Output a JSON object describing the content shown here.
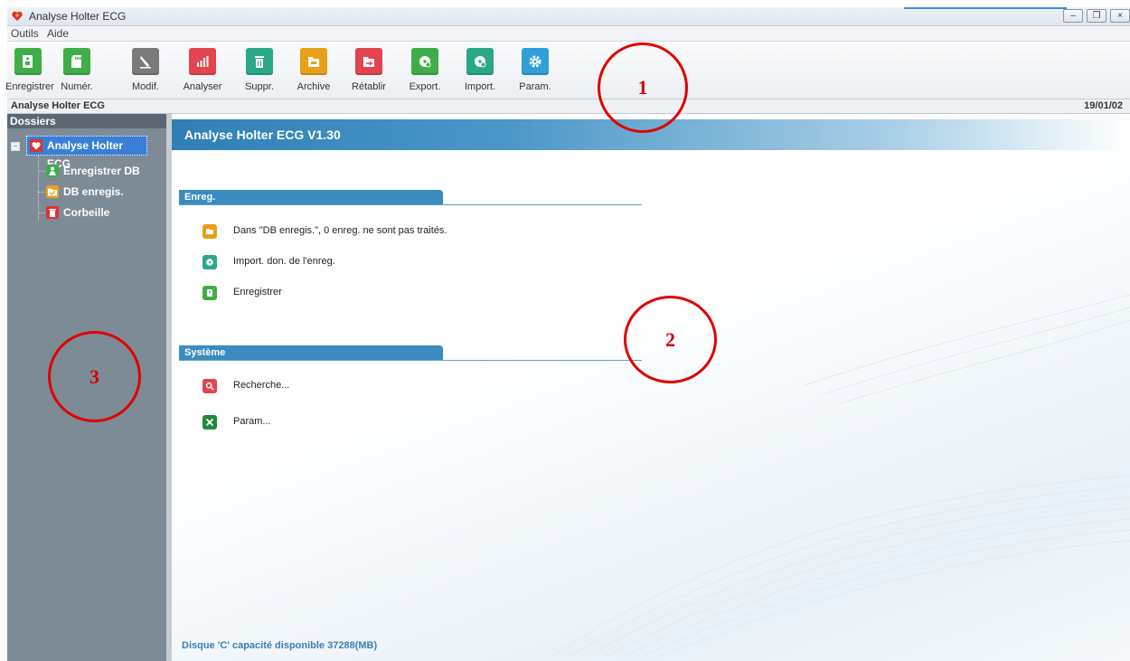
{
  "window": {
    "title": "Analyse Holter ECG"
  },
  "menu": {
    "items": [
      "Outils",
      "Aide"
    ]
  },
  "toolbar": {
    "buttons": [
      {
        "label": "Enregistrer",
        "icon": "record-icon",
        "color": "#3fae49"
      },
      {
        "label": "Numér.",
        "icon": "sd-card-icon",
        "color": "#3fae49"
      },
      {
        "label": "Modif.",
        "icon": "edit-pencil-icon",
        "color": "#7a7a7a"
      },
      {
        "label": "Analyser",
        "icon": "bar-chart-icon",
        "color": "#e2454f"
      },
      {
        "label": "Suppr.",
        "icon": "trash-icon",
        "color": "#2aa98a"
      },
      {
        "label": "Archive",
        "icon": "archive-folder-icon",
        "color": "#e8a01a"
      },
      {
        "label": "Rétablir",
        "icon": "restore-folder-icon",
        "color": "#e2454f"
      },
      {
        "label": "Export.",
        "icon": "export-disc-icon",
        "color": "#3fae49"
      },
      {
        "label": "Import.",
        "icon": "import-disc-icon",
        "color": "#2aa98a"
      },
      {
        "label": "Param.",
        "icon": "gear-icon",
        "color": "#2f9fd8"
      }
    ]
  },
  "status": {
    "left": "Analyse Holter ECG",
    "date": "19/01/02"
  },
  "sidebar": {
    "header": "Dossiers",
    "root": {
      "label": "Analyse Holter ECG",
      "icon": "heart-icon",
      "color": "#e0322e"
    },
    "items": [
      {
        "label": "Enregistrer DB",
        "icon": "person-icon",
        "color": "#3fae49"
      },
      {
        "label": "DB enregis.",
        "icon": "folder-icon",
        "color": "#e8a01a"
      },
      {
        "label": "Corbeille",
        "icon": "trash-icon",
        "color": "#e0322e"
      }
    ]
  },
  "main": {
    "title": "Analyse Holter ECG V1.30",
    "sections": [
      {
        "title": "Enreg.",
        "items": [
          {
            "label": "Dans \"DB enregis.\", 0 enreg. ne sont pas traités.",
            "icon": "folder-icon",
            "color": "#e8a01a"
          },
          {
            "label": "Import. don. de l'enreg.",
            "icon": "import-disc-icon",
            "color": "#2aa98a"
          },
          {
            "label": "Enregistrer",
            "icon": "record-icon",
            "color": "#3fae49"
          }
        ]
      },
      {
        "title": "Système",
        "items": [
          {
            "label": "Recherche...",
            "icon": "search-icon",
            "color": "#e2454f"
          },
          {
            "label": "Param...",
            "icon": "tools-icon",
            "color": "#1f8a3c"
          }
        ]
      }
    ],
    "footer": "Disque 'C' capacité disponible 37288(MB)"
  },
  "annotations": [
    "1",
    "2",
    "3"
  ]
}
